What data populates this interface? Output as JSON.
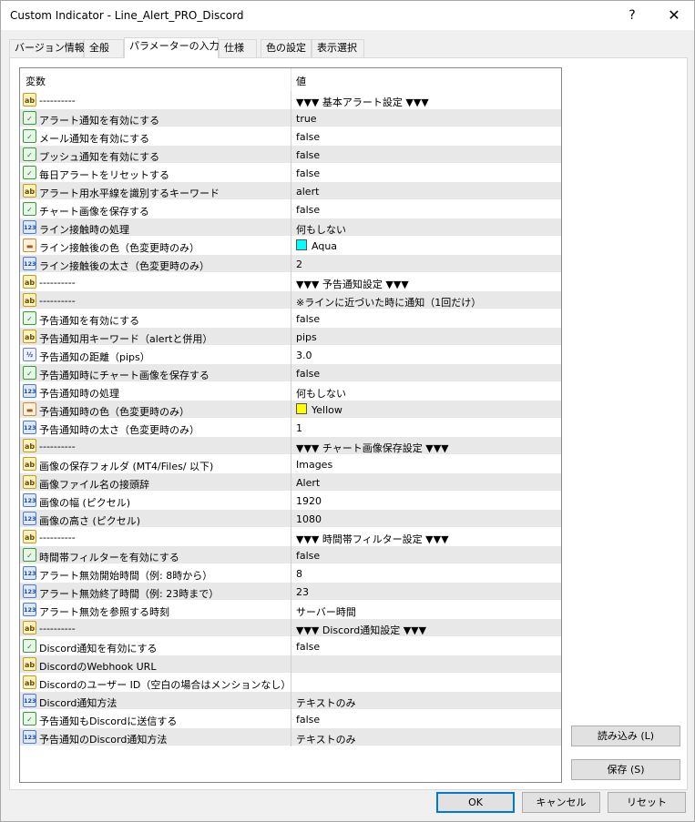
{
  "window": {
    "title": "Custom Indicator - Line_Alert_PRO_Discord",
    "help_glyph": "?",
    "close_glyph": "✕"
  },
  "tabs": [
    {
      "label": "バージョン情報",
      "active": false
    },
    {
      "label": "全般",
      "active": false
    },
    {
      "label": "パラメーターの入力",
      "active": true
    },
    {
      "label": "仕様",
      "active": false
    },
    {
      "label": "色の設定",
      "active": false
    },
    {
      "label": "表示選択",
      "active": false
    }
  ],
  "grid": {
    "col_variable": "変数",
    "col_value": "値",
    "rows": [
      {
        "icon": "ab",
        "name": "----------",
        "value": "▼▼▼ 基本アラート設定 ▼▼▼"
      },
      {
        "icon": "bool",
        "name": "アラート通知を有効にする",
        "value": "true"
      },
      {
        "icon": "bool",
        "name": "メール通知を有効にする",
        "value": "false"
      },
      {
        "icon": "bool",
        "name": "プッシュ通知を有効にする",
        "value": "false"
      },
      {
        "icon": "bool",
        "name": "毎日アラートをリセットする",
        "value": "false"
      },
      {
        "icon": "ab",
        "name": "アラート用水平線を識別するキーワード",
        "value": "alert"
      },
      {
        "icon": "bool",
        "name": "チャート画像を保存する",
        "value": "false"
      },
      {
        "icon": "int",
        "name": "ライン接触時の処理",
        "value": "何もしない"
      },
      {
        "icon": "color",
        "name": "ライン接触後の色（色変更時のみ）",
        "value": "Aqua",
        "swatch": "#00ffff"
      },
      {
        "icon": "int",
        "name": "ライン接触後の太さ（色変更時のみ）",
        "value": "2"
      },
      {
        "icon": "ab",
        "name": "----------",
        "value": "▼▼▼ 予告通知設定 ▼▼▼"
      },
      {
        "icon": "ab",
        "name": "----------",
        "value": "※ラインに近づいた時に通知（1回だけ）"
      },
      {
        "icon": "bool",
        "name": "予告通知を有効にする",
        "value": "false"
      },
      {
        "icon": "ab",
        "name": "予告通知用キーワード（alertと併用）",
        "value": "pips"
      },
      {
        "icon": "dbl",
        "name": "予告通知の距離（pips）",
        "value": "3.0"
      },
      {
        "icon": "bool",
        "name": "予告通知時にチャート画像を保存する",
        "value": "false"
      },
      {
        "icon": "int",
        "name": "予告通知時の処理",
        "value": "何もしない"
      },
      {
        "icon": "color",
        "name": "予告通知時の色（色変更時のみ）",
        "value": "Yellow",
        "swatch": "#ffff00"
      },
      {
        "icon": "int",
        "name": "予告通知時の太さ（色変更時のみ）",
        "value": "1"
      },
      {
        "icon": "ab",
        "name": "----------",
        "value": "▼▼▼ チャート画像保存設定 ▼▼▼"
      },
      {
        "icon": "ab",
        "name": "画像の保存フォルダ (MT4/Files/ 以下)",
        "value": "Images"
      },
      {
        "icon": "ab",
        "name": "画像ファイル名の接頭辞",
        "value": "Alert"
      },
      {
        "icon": "int",
        "name": "画像の幅 (ピクセル)",
        "value": "1920"
      },
      {
        "icon": "int",
        "name": "画像の高さ (ピクセル)",
        "value": "1080"
      },
      {
        "icon": "ab",
        "name": "----------",
        "value": "▼▼▼ 時間帯フィルター設定 ▼▼▼"
      },
      {
        "icon": "bool",
        "name": "時間帯フィルターを有効にする",
        "value": "false"
      },
      {
        "icon": "int",
        "name": "アラート無効開始時間（例: 8時から）",
        "value": "8"
      },
      {
        "icon": "int",
        "name": "アラート無効終了時間（例: 23時まで）",
        "value": "23"
      },
      {
        "icon": "int",
        "name": "アラート無効を参照する時刻",
        "value": "サーバー時間"
      },
      {
        "icon": "ab",
        "name": "----------",
        "value": "▼▼▼ Discord通知設定 ▼▼▼"
      },
      {
        "icon": "bool",
        "name": "Discord通知を有効にする",
        "value": "false"
      },
      {
        "icon": "ab",
        "name": "DiscordのWebhook URL",
        "value": ""
      },
      {
        "icon": "ab",
        "name": "Discordのユーザー ID（空白の場合はメンションなし）",
        "value": ""
      },
      {
        "icon": "int",
        "name": "Discord通知方法",
        "value": "テキストのみ"
      },
      {
        "icon": "bool",
        "name": "予告通知もDiscordに送信する",
        "value": "false"
      },
      {
        "icon": "int",
        "name": "予告通知のDiscord通知方法",
        "value": "テキストのみ"
      }
    ]
  },
  "side_buttons": {
    "load": "読み込み (L)",
    "save": "保存 (S)"
  },
  "footer_buttons": {
    "ok": "OK",
    "cancel": "キャンセル",
    "reset": "リセット"
  }
}
